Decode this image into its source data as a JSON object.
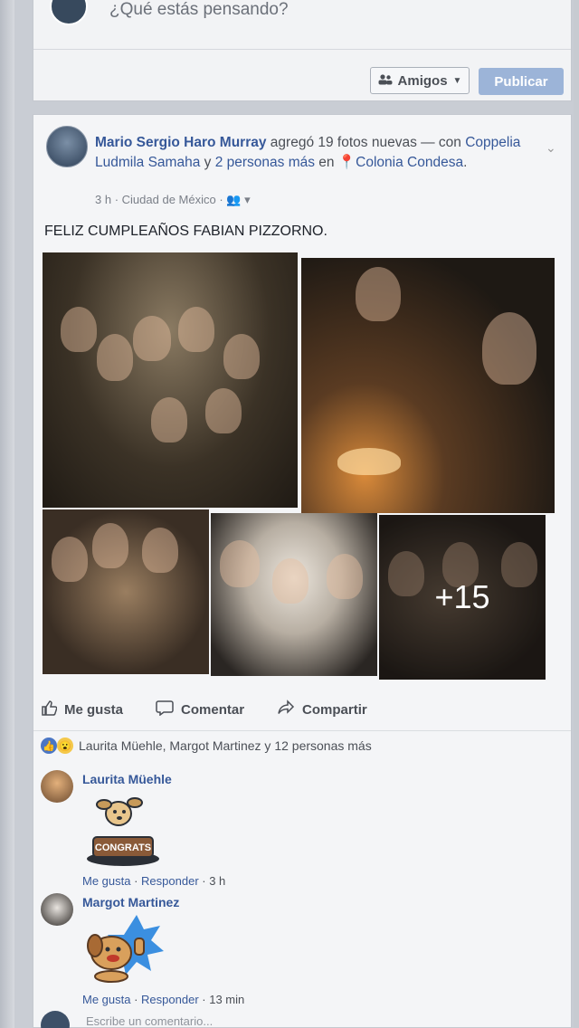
{
  "composer": {
    "placeholder": "¿Qué estás pensando?",
    "audience_label": "Amigos",
    "publish_label": "Publicar"
  },
  "post": {
    "author": "Mario Sergio Haro Murray",
    "action": " agregó 19 fotos nuevas — con ",
    "tagged_1": "Coppelia Ludmila Samaha",
    "and": " y ",
    "tagged_others": "2 personas más",
    "location_prefix": " en ",
    "location": "Colonia Condesa",
    "location_suffix": ".",
    "time": "3 h",
    "place": "Ciudad de México",
    "text": "FELIZ CUMPLEAÑOS FABIAN PIZZORNO.",
    "more_photos": "+15"
  },
  "actions": {
    "like": "Me gusta",
    "comment": "Comentar",
    "share": "Compartir"
  },
  "reactions": {
    "summary": "Laurita Müehle, Margot Martinez y 12 personas más"
  },
  "comments": [
    {
      "name": "Laurita Müehle",
      "sticker_text": "CONGRATS",
      "like": "Me gusta",
      "reply": "Responder",
      "time": "3 h"
    },
    {
      "name": "Margot Martinez",
      "like": "Me gusta",
      "reply": "Responder",
      "time": "13 min"
    }
  ],
  "comment_box": {
    "placeholder": "Escribe un comentario..."
  }
}
